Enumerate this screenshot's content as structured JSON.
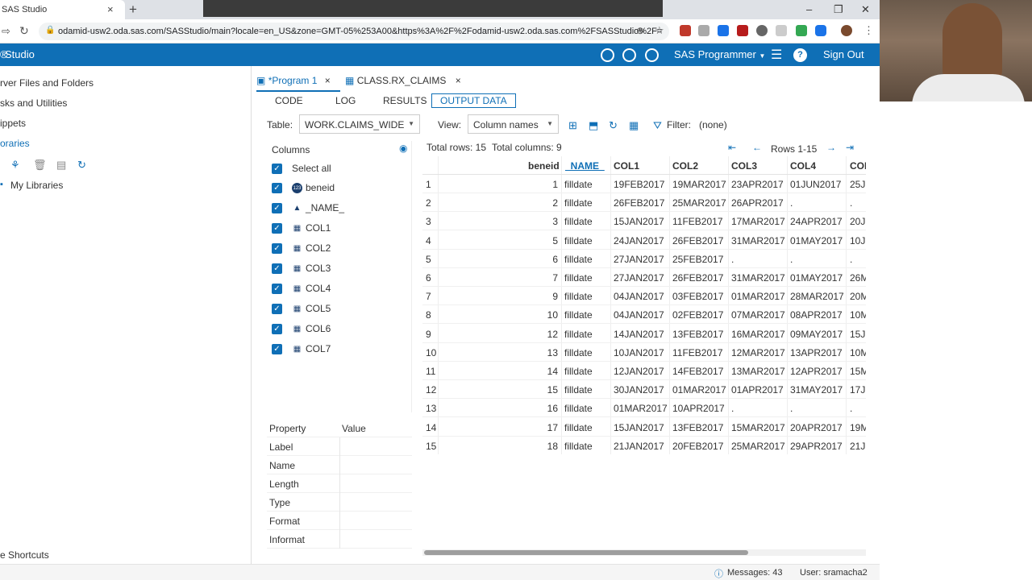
{
  "browser": {
    "tab_title": "SAS Studio",
    "tab_close": "×",
    "new_tab": "+",
    "url": "odamid-usw2.oda.sas.com/SASStudio/main?locale=en_US&zone=GMT-05%253A00&https%3A%2F%2Fodamid-usw2.oda.sas.com%2FSASStudio%2F=",
    "window_controls": [
      "–",
      "❐",
      "✕"
    ]
  },
  "appbar": {
    "title": "Studio",
    "user_role": "SAS Programmer",
    "sign_out": "Sign Out",
    "help": "?"
  },
  "navigation": {
    "items": [
      "rver Files and Folders",
      "sks and Utilities",
      "ippets",
      "oraries"
    ],
    "my_libraries": "My Libraries",
    "shortcuts": "e Shortcuts"
  },
  "editor_tabs": [
    {
      "label": "*Program 1",
      "close": "×"
    },
    {
      "label": "CLASS.RX_CLAIMS",
      "close": "×"
    }
  ],
  "subtabs": [
    "CODE",
    "LOG",
    "RESULTS",
    "OUTPUT DATA"
  ],
  "toolbar": {
    "table_label": "Table:",
    "table_value": "WORK.CLAIMS_WIDE",
    "view_label": "View:",
    "view_value": "Column names",
    "filter_label": "Filter:",
    "filter_value": "(none)"
  },
  "columns_panel": {
    "title": "Columns",
    "select_all": "Select all",
    "items": [
      {
        "name": "beneid",
        "type_icon": "123"
      },
      {
        "name": "_NAME_",
        "type_icon": "▲"
      },
      {
        "name": "COL1",
        "type_icon": "▦"
      },
      {
        "name": "COL2",
        "type_icon": "▦"
      },
      {
        "name": "COL3",
        "type_icon": "▦"
      },
      {
        "name": "COL4",
        "type_icon": "▦"
      },
      {
        "name": "COL5",
        "type_icon": "▦"
      },
      {
        "name": "COL6",
        "type_icon": "▦"
      },
      {
        "name": "COL7",
        "type_icon": "▦"
      }
    ]
  },
  "properties": {
    "header": [
      "Property",
      "Value"
    ],
    "rows": [
      "Label",
      "Name",
      "Length",
      "Type",
      "Format",
      "Informat"
    ]
  },
  "grid": {
    "total_rows": "Total rows: 15",
    "total_columns": "Total columns: 9",
    "rows_range": "Rows 1-15",
    "headers": [
      "beneid",
      "_NAME_",
      "COL1",
      "COL2",
      "COL3",
      "COL4",
      "COL"
    ],
    "rows": [
      [
        "1",
        "1",
        "filldate",
        "19FEB2017",
        "19MAR2017",
        "23APR2017",
        "01JUN2017",
        "25J"
      ],
      [
        "2",
        "2",
        "filldate",
        "26FEB2017",
        "25MAR2017",
        "26APR2017",
        ".",
        "."
      ],
      [
        "3",
        "3",
        "filldate",
        "15JAN2017",
        "11FEB2017",
        "17MAR2017",
        "24APR2017",
        "20J"
      ],
      [
        "4",
        "5",
        "filldate",
        "24JAN2017",
        "26FEB2017",
        "31MAR2017",
        "01MAY2017",
        "10J"
      ],
      [
        "5",
        "6",
        "filldate",
        "27JAN2017",
        "25FEB2017",
        ".",
        ".",
        "."
      ],
      [
        "6",
        "7",
        "filldate",
        "27JAN2017",
        "26FEB2017",
        "31MAR2017",
        "01MAY2017",
        "26M"
      ],
      [
        "7",
        "9",
        "filldate",
        "04JAN2017",
        "03FEB2017",
        "01MAR2017",
        "28MAR2017",
        "20M"
      ],
      [
        "8",
        "10",
        "filldate",
        "04JAN2017",
        "02FEB2017",
        "07MAR2017",
        "08APR2017",
        "10M"
      ],
      [
        "9",
        "12",
        "filldate",
        "14JAN2017",
        "13FEB2017",
        "16MAR2017",
        "09MAY2017",
        "15J"
      ],
      [
        "10",
        "13",
        "filldate",
        "10JAN2017",
        "11FEB2017",
        "12MAR2017",
        "13APR2017",
        "10M"
      ],
      [
        "11",
        "14",
        "filldate",
        "12JAN2017",
        "14FEB2017",
        "13MAR2017",
        "12APR2017",
        "15M"
      ],
      [
        "12",
        "15",
        "filldate",
        "30JAN2017",
        "01MAR2017",
        "01APR2017",
        "31MAY2017",
        "17J"
      ],
      [
        "13",
        "16",
        "filldate",
        "01MAR2017",
        "10APR2017",
        ".",
        ".",
        "."
      ],
      [
        "14",
        "17",
        "filldate",
        "15JAN2017",
        "13FEB2017",
        "15MAR2017",
        "20APR2017",
        "19M"
      ],
      [
        "15",
        "18",
        "filldate",
        "21JAN2017",
        "20FEB2017",
        "25MAR2017",
        "29APR2017",
        "21J"
      ]
    ]
  },
  "statusbar": {
    "messages": "Messages: 43",
    "user": "User: sramacha2"
  },
  "colors": {
    "brand_blue": "#0f6fb6",
    "chrome_gray": "#dee1e6"
  }
}
